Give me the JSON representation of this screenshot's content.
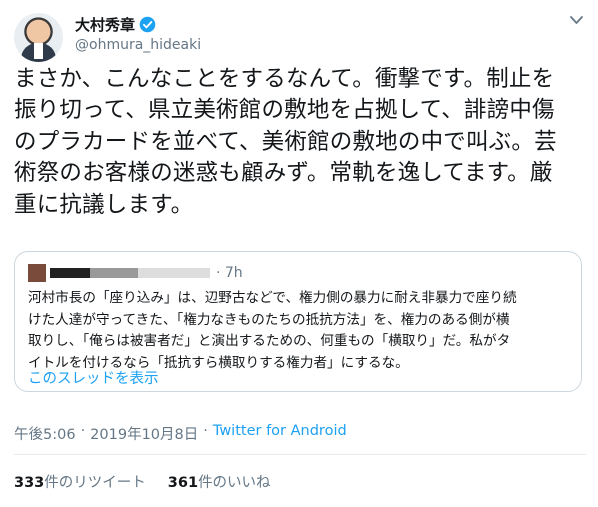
{
  "author": {
    "display_name": "大村秀章",
    "handle": "@ohmura_hideaki"
  },
  "tweet": {
    "text": "まさか、こんなことをするなんて。衝撃です。制止を\n振り切って、県立美術館の敷地を占拠して、誹謗中傷\nのプラカードを並べて、美術館の敷地の中で叫ぶ。芸\n術祭のお客様の迷惑も顧みず。常軌を逸してます。厳\n重に抗議します。"
  },
  "quoted_tweet": {
    "time": "· 7h",
    "text": "河村市長の「座り込み」は、辺野古などで、権力側の暴力に耐え非暴力で座り続\nけた人達が守ってきた、「権力なきものたちの抵抗方法」を、権力のある側が横\n取りし、「俺らは被害者だ」と演出するための、何重もの「横取り」だ。私がタ\nイトルを付けるなら「抵抗すら横取りする権力者」にするな。",
    "show_thread": "このスレッドを表示"
  },
  "meta": {
    "time": "午後5:06",
    "date": "2019年10月8日",
    "separator": "·",
    "via": "Twitter for Android"
  },
  "stats": {
    "retweets_count": "333",
    "retweets_label": "件のリツイート",
    "likes_count": "361",
    "likes_label": "件のいいね"
  },
  "colors": {
    "accent": "#1da1f2",
    "secondary_text": "#657786",
    "border": "#ccd6dd"
  },
  "icons": {
    "verified": "verified-badge-icon",
    "menu": "chevron-down-icon"
  }
}
